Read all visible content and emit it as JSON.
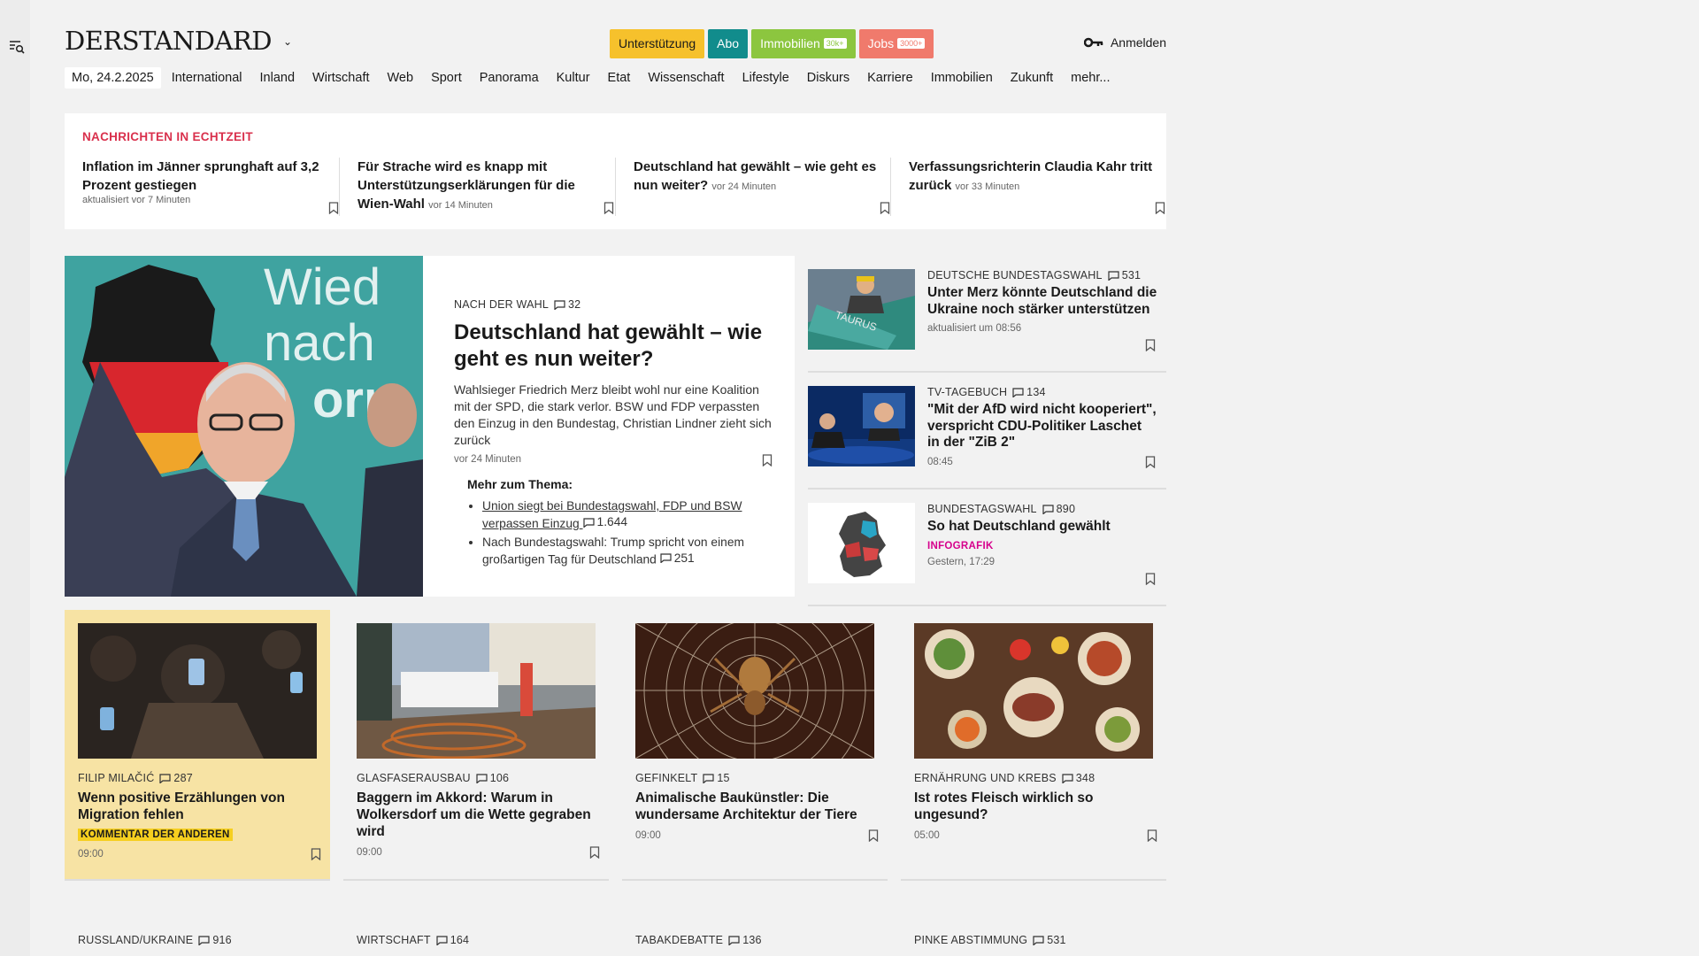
{
  "logo": {
    "text": "DERSTANDARD"
  },
  "header": {
    "pills": [
      {
        "label": "Unterstützung",
        "bg": "#f6c12c",
        "fg": "#1a1a1a",
        "tag": ""
      },
      {
        "label": "Abo",
        "bg": "#118c8c",
        "fg": "#ffffff",
        "tag": ""
      },
      {
        "label": "Immobilien",
        "bg": "#8cc63f",
        "fg": "#ffffff",
        "tag": "30k+"
      },
      {
        "label": "Jobs",
        "bg": "#f07a6c",
        "fg": "#ffffff",
        "tag": "3000+"
      }
    ],
    "login_label": "Anmelden"
  },
  "nav": {
    "date": "Mo, 24.2.2025",
    "items": [
      "International",
      "Inland",
      "Wirtschaft",
      "Web",
      "Sport",
      "Panorama",
      "Kultur",
      "Etat",
      "Wissenschaft",
      "Lifestyle",
      "Diskurs",
      "Karriere",
      "Immobilien",
      "Zukunft",
      "mehr..."
    ]
  },
  "ticker": {
    "heading": "NACHRICHTEN IN ECHTZEIT",
    "items": [
      {
        "title": "Inflation im Jänner sprunghaft auf 3,2 Prozent gestiegen",
        "meta": "aktualisiert vor 7 Minuten"
      },
      {
        "title": "Für Strache wird es knapp mit Unterstützungserklärungen für die Wien-Wahl",
        "meta": "vor 14 Minuten"
      },
      {
        "title": "Deutschland hat gewählt – wie geht es nun weiter?",
        "meta": "vor 24 Minuten"
      },
      {
        "title": "Verfassungsrichterin Claudia Kahr tritt zurück",
        "meta": "vor 33 Minuten"
      }
    ]
  },
  "hero": {
    "image_text": "Wied nach orn",
    "kicker": "NACH DER WAHL",
    "comments": "32",
    "title": "Deutschland hat gewählt – wie geht es nun weiter?",
    "lead": "Wahlsieger Friedrich Merz bleibt wohl nur eine Koalition mit der SPD, die stark verlor. BSW und FDP verpassten den Einzug in den Bundestag, Christian Lindner zieht sich zurück",
    "time": "vor 24 Minuten",
    "more_heading": "Mehr zum Thema:",
    "more": [
      {
        "text": "Union siegt bei Bundestagswahl, FDP und BSW verpassen Einzug",
        "comments": "1.644",
        "link": true
      },
      {
        "text": "Nach Bundestagswahl: Trump spricht von einem großartigen Tag für Deutschland",
        "comments": "251",
        "link": false
      }
    ]
  },
  "side": [
    {
      "kicker": "DEUTSCHE BUNDESTAGSWAHL",
      "comments": "531",
      "title": "Unter Merz könnte Deutschland die Ukraine noch stärker unterstützen",
      "tag": "",
      "time": "aktualisiert um 08:56",
      "thumb_text": "TAURUS"
    },
    {
      "kicker": "TV-TAGEBUCH",
      "comments": "134",
      "title": "\"Mit der AfD wird nicht kooperiert\", verspricht CDU-Politiker Laschet in der \"ZiB 2\"",
      "tag": "",
      "time": "08:45",
      "thumb_text": ""
    },
    {
      "kicker": "BUNDESTAGSWAHL",
      "comments": "890",
      "title": "So hat Deutschland gewählt",
      "tag": "INFOGRAFIK",
      "time": "Gestern, 17:29",
      "thumb_text": ""
    }
  ],
  "cards": [
    {
      "kicker": "FILIP MILAČIĆ",
      "comments": "287",
      "title": "Wenn positive Erzählungen von Migration fehlen",
      "tag": "KOMMENTAR DER ANDEREN",
      "time": "09:00"
    },
    {
      "kicker": "GLASFASERAUSBAU",
      "comments": "106",
      "title": "Baggern im Akkord: Warum in Wolkersdorf um die Wette gegraben wird",
      "tag": "",
      "time": "09:00"
    },
    {
      "kicker": "GEFINKELT",
      "comments": "15",
      "title": "Animalische Baukünstler: Die wundersame Architektur der Tiere",
      "tag": "",
      "time": "09:00"
    },
    {
      "kicker": "ERNÄHRUNG UND KREBS",
      "comments": "348",
      "title": "Ist rotes Fleisch wirklich so ungesund?",
      "tag": "",
      "time": "05:00"
    }
  ],
  "bottom": [
    {
      "kicker": "RUSSLAND/UKRAINE",
      "comments": "916"
    },
    {
      "kicker": "WIRTSCHAFT",
      "comments": "164"
    },
    {
      "kicker": "TABAKDEBATTE",
      "comments": "136"
    },
    {
      "kicker": "PINKE ABSTIMMUNG",
      "comments": "531"
    }
  ]
}
